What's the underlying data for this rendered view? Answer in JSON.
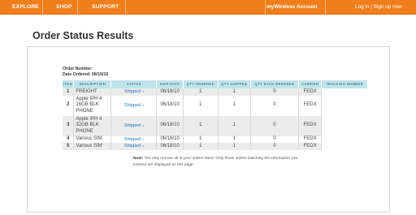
{
  "nav": {
    "items": [
      "EXPLORE",
      "SHOP",
      "SUPPORT"
    ],
    "account": "myWireless Account",
    "auth_links": "Log in | Sign up now"
  },
  "page": {
    "title": "Order Status Results"
  },
  "order": {
    "number_label": "Order Number:",
    "date_label": "Date Ordered: 06/15/10"
  },
  "table": {
    "headers": [
      "ITEM",
      "DESCRIPTION",
      "STATUS",
      "SHIP DATE",
      "QTY ORDERED",
      "QTY SHIPPED",
      "QTY BACK-ORDERED",
      "CARRIER",
      "TRACKING NUMBER"
    ],
    "rows": [
      {
        "item": "1",
        "description": "FREIGHT",
        "status": "Shipped",
        "ship_date": "06/18/10",
        "qty_ordered": "1",
        "qty_shipped": "1",
        "qty_backordered": "0",
        "carrier": "FEDX",
        "tracking": ""
      },
      {
        "item": "2",
        "description": "Apple IPH 4 16GB BLK PHONE",
        "status": "Shipped",
        "ship_date": "06/18/10",
        "qty_ordered": "1",
        "qty_shipped": "1",
        "qty_backordered": "0",
        "carrier": "FEDX",
        "tracking": ""
      },
      {
        "item": "3",
        "description": "Apple IPH 4 32GB BLK PHONE",
        "status": "Shipped",
        "ship_date": "06/18/10",
        "qty_ordered": "1",
        "qty_shipped": "1",
        "qty_backordered": "0",
        "carrier": "FEDX",
        "tracking": ""
      },
      {
        "item": "4",
        "description": "Various SIM",
        "status": "Shipped",
        "ship_date": "06/18/10",
        "qty_ordered": "1",
        "qty_shipped": "1",
        "qty_backordered": "0",
        "carrier": "FEDX",
        "tracking": ""
      },
      {
        "item": "5",
        "description": "Various SIM",
        "status": "Shipped",
        "ship_date": "06/18/10",
        "qty_ordered": "1",
        "qty_shipped": "1",
        "qty_backordered": "0",
        "carrier": "FEDX",
        "tracking": ""
      }
    ]
  },
  "note": {
    "label": "Note:",
    "text": "You may not see all of your orders listed. Only those orders matching the information you entered are displayed on this page."
  },
  "colors": {
    "nav_bg": "#f07f1b",
    "header_bg": "#bfe4ec",
    "link": "#1f74c1",
    "row_shade": "#ececec"
  },
  "icons": {
    "status_link": "chevron-right-icon"
  }
}
